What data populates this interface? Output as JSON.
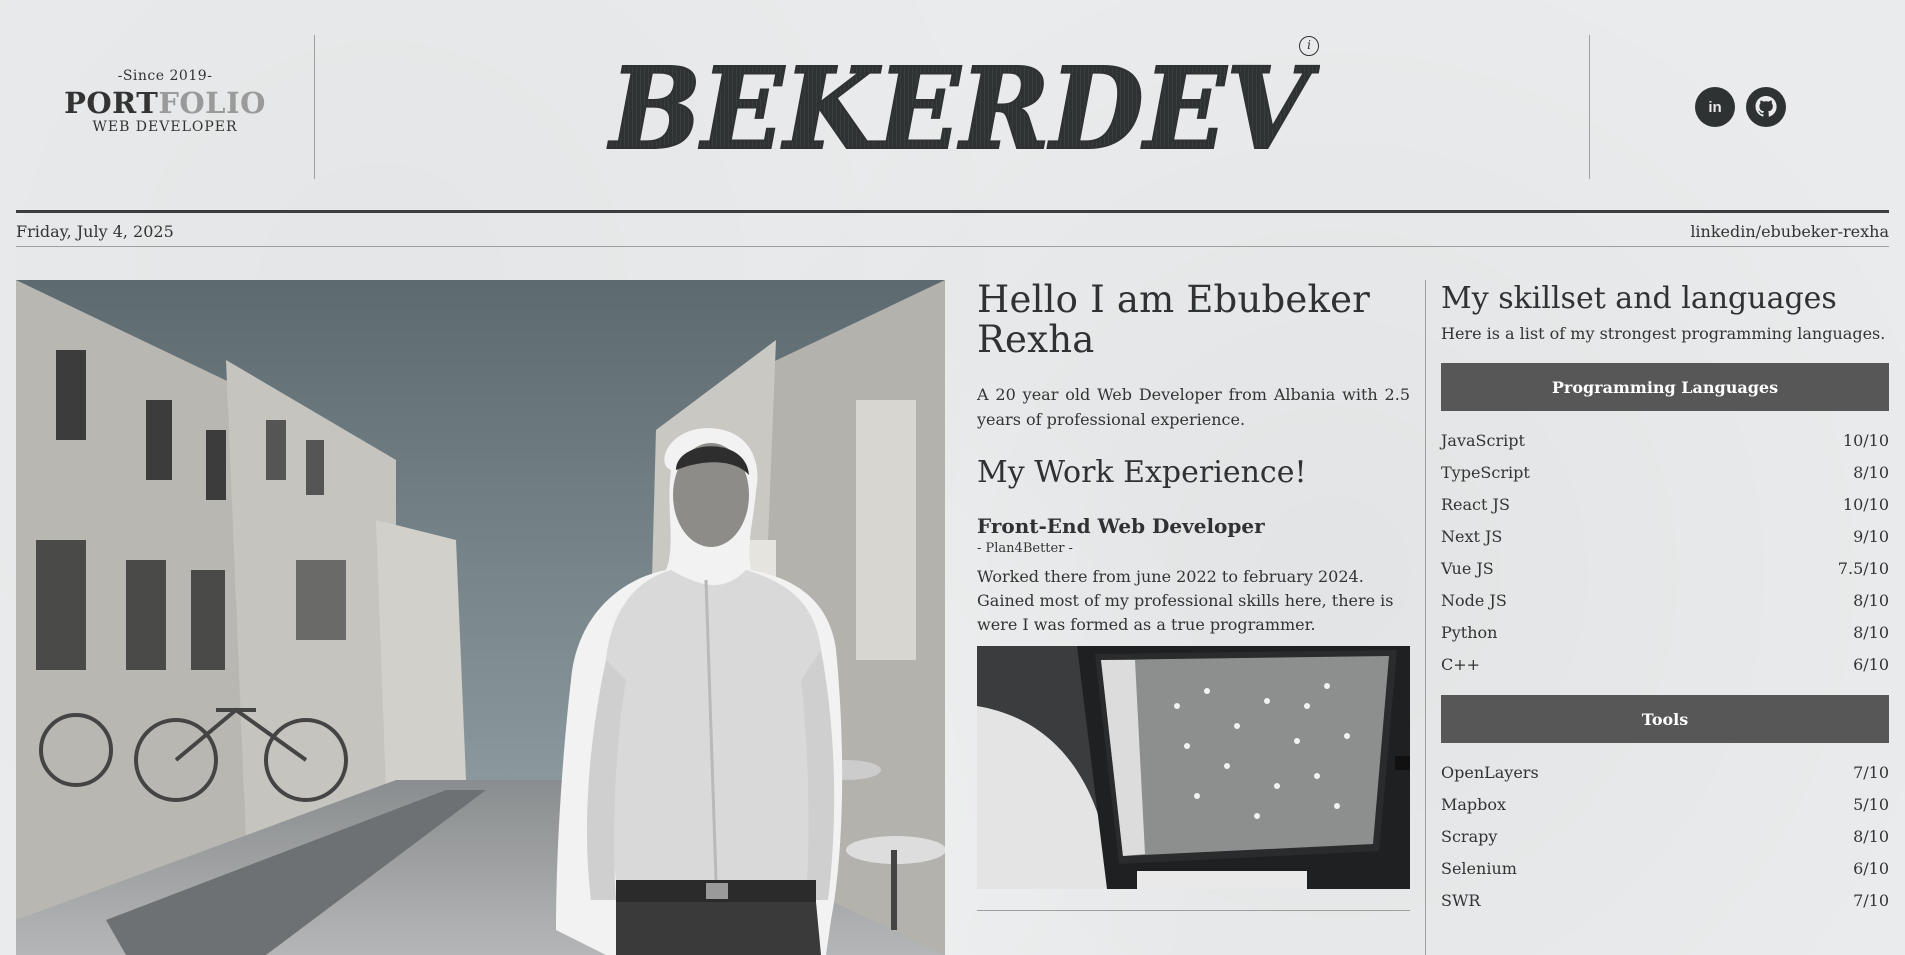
{
  "brand": {
    "since": "-Since 2019-",
    "word_a": "PORT",
    "word_b": "FOLIO",
    "role": "WEB DEVELOPER"
  },
  "logo": {
    "text": "BEKERDEV"
  },
  "info_icon": {
    "glyph": "i"
  },
  "socials": [
    {
      "name": "linkedin-icon",
      "glyph": "in"
    },
    {
      "name": "github-icon"
    }
  ],
  "datebar": {
    "date": "Friday, July 4, 2025",
    "linkedin": "linkedin/ebubeker-rexha"
  },
  "intro": {
    "title": "Hello I am Ebubeker Rexha",
    "text": "A 20 year old Web Developer from Albania with 2.5 years of professional experience."
  },
  "experience": {
    "heading": "My Work Experience!",
    "job_title": "Front-End Web Developer",
    "company": "- Plan4Better -",
    "description": "Worked there from june 2022 to february 2024. Gained most of my professional skills here, there is were I was formed as a true programmer."
  },
  "skills": {
    "heading": "My skillset and languages",
    "subtitle": "Here is a list of my strongest programming languages.",
    "languages_label": "Programming Languages",
    "languages": [
      {
        "name": "JavaScript",
        "score": "10/10"
      },
      {
        "name": "TypeScript",
        "score": "8/10"
      },
      {
        "name": "React JS",
        "score": "10/10"
      },
      {
        "name": "Next JS",
        "score": "9/10"
      },
      {
        "name": "Vue JS",
        "score": "7.5/10"
      },
      {
        "name": "Node JS",
        "score": "8/10"
      },
      {
        "name": "Python",
        "score": "8/10"
      },
      {
        "name": "C++",
        "score": "6/10"
      }
    ],
    "tools_label": "Tools",
    "tools": [
      {
        "name": "OpenLayers",
        "score": "7/10"
      },
      {
        "name": "Mapbox",
        "score": "5/10"
      },
      {
        "name": "Scrapy",
        "score": "8/10"
      },
      {
        "name": "Selenium",
        "score": "6/10"
      },
      {
        "name": "SWR",
        "score": "7/10"
      }
    ]
  },
  "colors": {
    "paper": "#e9ebec",
    "ink": "#2f3233",
    "panel": "#575757",
    "accent_grey": "#9a9a9a"
  }
}
